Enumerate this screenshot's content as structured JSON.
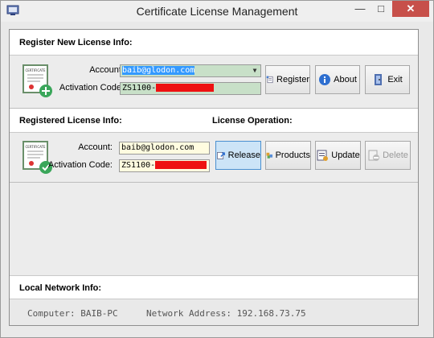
{
  "window": {
    "title": "Certificate License Management",
    "close_glyph": "✕",
    "min_glyph": "—",
    "max_glyph": "□"
  },
  "register": {
    "heading": "Register New License Info:",
    "account_label": "Account:",
    "account_value": "baib@glodon.com",
    "activation_label": "Activation Code:",
    "activation_value": "ZS1100-",
    "buttons": {
      "register": "Register",
      "about": "About",
      "exit": "Exit"
    }
  },
  "registered": {
    "heading": "Registered License Info:",
    "operation_heading": "License Operation:",
    "account_label": "Account:",
    "account_value": "baib@glodon.com",
    "activation_label": "Activation Code:",
    "activation_value": "ZS1100-",
    "buttons": {
      "release": "Release",
      "products": "Products",
      "update": "Update",
      "delete": "Delete"
    }
  },
  "network": {
    "heading": "Local Network Info:",
    "computer": "Computer: BAIB-PC",
    "address": "Network Address: 192.168.73.75"
  },
  "colors": {
    "redaction": "#ee1111",
    "field_green": "#c8e0c8",
    "field_yellow": "#fffce0",
    "active_button": "#cce4f7"
  }
}
